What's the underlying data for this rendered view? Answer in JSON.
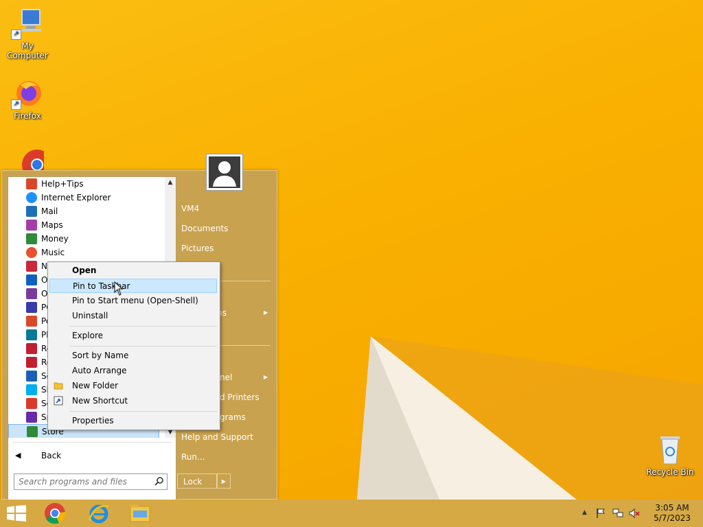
{
  "desktop": {
    "icons": [
      {
        "label": "My Computer",
        "icon": "computer-icon"
      },
      {
        "label": "Firefox",
        "icon": "firefox-icon"
      },
      {
        "label": "",
        "icon": "chrome-icon"
      },
      {
        "label": "Recycle Bin",
        "icon": "recycle-bin-icon"
      }
    ]
  },
  "start_menu": {
    "programs": [
      {
        "label": "Help+Tips",
        "icon": "help-icon",
        "color": "#d9472b"
      },
      {
        "label": "Internet Explorer",
        "icon": "ie-icon",
        "color": "#1e90ff"
      },
      {
        "label": "Mail",
        "icon": "mail-icon",
        "color": "#1f6fb8"
      },
      {
        "label": "Maps",
        "icon": "maps-icon",
        "color": "#a33ea8"
      },
      {
        "label": "Money",
        "icon": "money-icon",
        "color": "#2e8b3a"
      },
      {
        "label": "Music",
        "icon": "music-icon",
        "color": "#e8512d"
      },
      {
        "label": "Ne",
        "icon": "news-icon",
        "color": "#c8283a"
      },
      {
        "label": "Or",
        "icon": "onedrive-icon",
        "color": "#1060c0"
      },
      {
        "label": "Or",
        "icon": "onenote-icon",
        "color": "#7a3c9c"
      },
      {
        "label": "PC",
        "icon": "pc-settings-icon",
        "color": "#3a3aaa"
      },
      {
        "label": "Pe",
        "icon": "people-icon",
        "color": "#d84a2a"
      },
      {
        "label": "Ph",
        "icon": "photos-icon",
        "color": "#0a7a96"
      },
      {
        "label": "Re",
        "icon": "reader-icon",
        "color": "#c02030"
      },
      {
        "label": "Re",
        "icon": "reading-list-icon",
        "color": "#c02030"
      },
      {
        "label": "Sc",
        "icon": "scan-icon",
        "color": "#1c5fb8"
      },
      {
        "label": "Sk",
        "icon": "skype-icon",
        "color": "#00aff0"
      },
      {
        "label": "So",
        "icon": "sound-recorder-icon",
        "color": "#d93a2a"
      },
      {
        "label": "Sp",
        "icon": "sports-icon",
        "color": "#6a2aa8"
      },
      {
        "label": "Store",
        "icon": "store-icon",
        "color": "#2e8b3a"
      }
    ],
    "back_label": "Back",
    "search_placeholder": "Search programs and files",
    "right_items": {
      "user": "VM4",
      "documents": "Documents",
      "pictures": "Pictures",
      "programs": "ms",
      "control_panel": "nel",
      "devices": "d Printers",
      "default_programs": "grams",
      "help": "Help and Support",
      "run": "Run..."
    },
    "lock_label": "Lock"
  },
  "context_menu": {
    "items": {
      "open": "Open",
      "pin_taskbar": "Pin to Taskbar",
      "pin_start": "Pin to Start menu (Open-Shell)",
      "uninstall": "Uninstall",
      "explore": "Explore",
      "sort_name": "Sort by Name",
      "auto_arrange": "Auto Arrange",
      "new_folder": "New Folder",
      "new_shortcut": "New Shortcut",
      "properties": "Properties"
    }
  },
  "taskbar": {
    "apps": [
      "chrome-icon",
      "internet-explorer-icon",
      "file-explorer-icon"
    ],
    "time": "3:05 AM",
    "date": "5/7/2023"
  }
}
